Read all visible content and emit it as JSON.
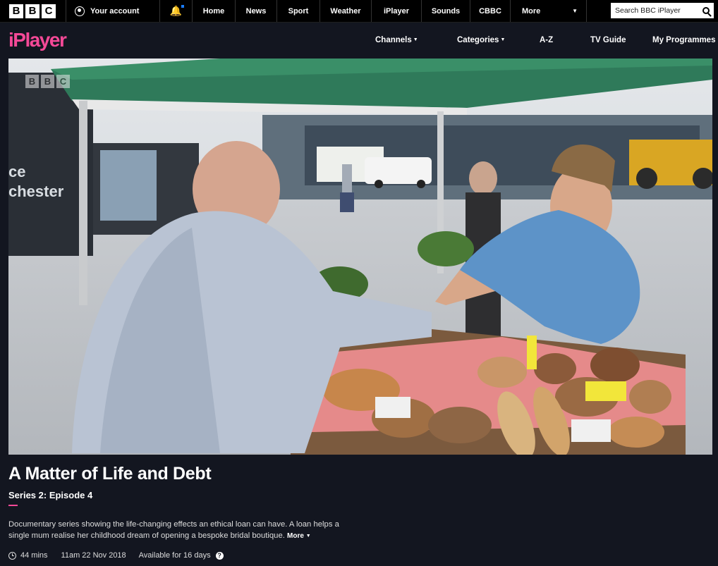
{
  "bbc_bar": {
    "logo_letters": [
      "B",
      "B",
      "C"
    ],
    "account_label": "Your account",
    "nav_links": [
      "Home",
      "News",
      "Sport",
      "Weather",
      "iPlayer",
      "Sounds",
      "CBBC"
    ],
    "more_label": "More",
    "search_placeholder": "Search BBC iPlayer"
  },
  "header": {
    "logo": "iPlayer",
    "nav": {
      "channels": "Channels",
      "categories": "Categories",
      "az": "A-Z",
      "tv_guide": "TV Guide",
      "my_programmes": "My Programmes"
    }
  },
  "programme": {
    "title": "A Matter of Life and Debt",
    "subtitle": "Series 2: Episode 4",
    "synopsis": "Documentary series showing the life-changing effects an ethical loan can have. A loan helps a single mum realise her childhood dream of opening a bespoke bridal boutique.",
    "more_label": "More",
    "duration": "44 mins",
    "broadcast": "11am 22 Nov 2018",
    "availability": "Available for 16 days"
  },
  "video": {
    "watermark": [
      "B",
      "B",
      "C"
    ]
  },
  "colors": {
    "background": "#131620",
    "accent": "#f54997",
    "topbar": "#000000"
  }
}
